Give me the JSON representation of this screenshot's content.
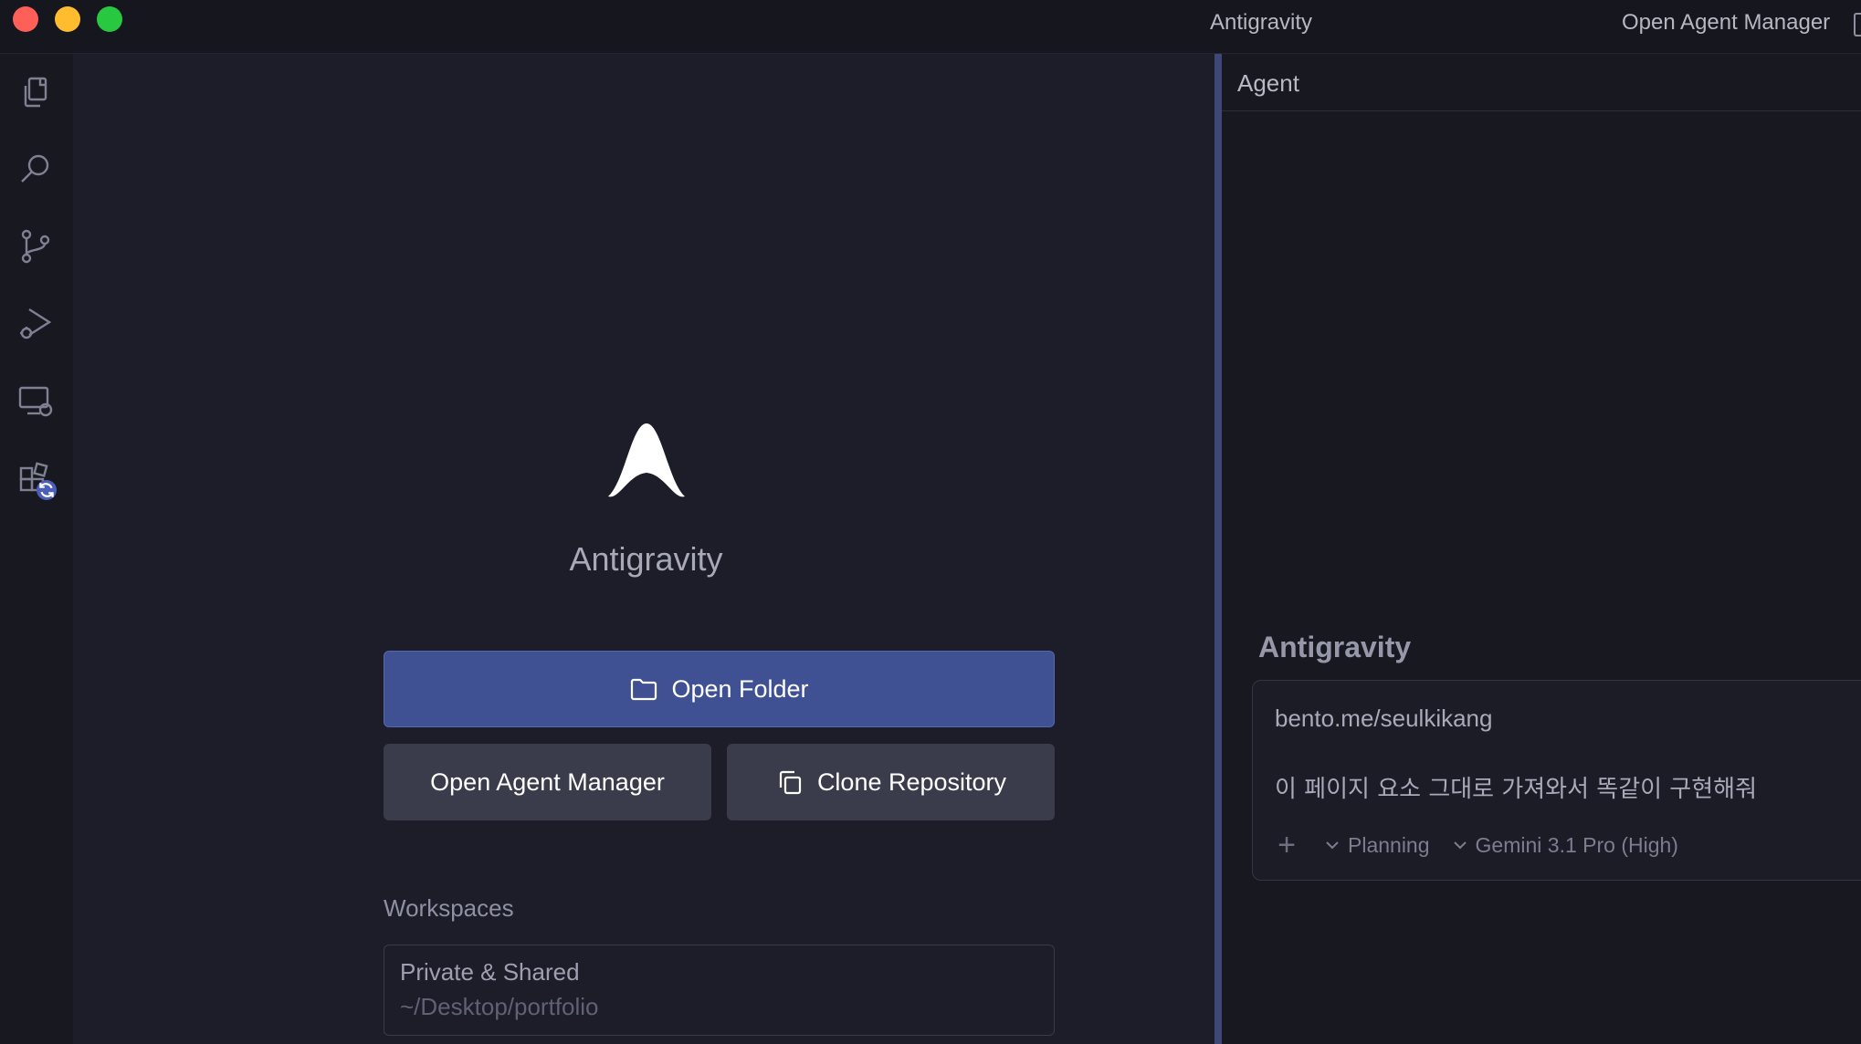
{
  "window": {
    "title": "Antigravity",
    "open_agent_manager": "Open Agent Manager"
  },
  "activity_bar": {
    "icons": [
      "explorer-icon",
      "search-icon",
      "source-control-icon",
      "run-debug-icon",
      "remote-explorer-icon",
      "extensions-icon"
    ]
  },
  "welcome": {
    "brand": "Antigravity",
    "open_folder": "Open Folder",
    "open_agent_manager": "Open Agent Manager",
    "clone_repository": "Clone Repository",
    "workspaces_heading": "Workspaces",
    "workspace": {
      "name": "Private & Shared",
      "path": "~/Desktop/portfolio"
    }
  },
  "agent_panel": {
    "header": "Agent",
    "title": "Antigravity",
    "prompt_line1": "bento.me/seulkikang",
    "prompt_line2": "이 페이지 요소 그대로 가져와서 똑같이 구현해줘",
    "mode": "Planning",
    "model": "Gemini 3.1 Pro (High)"
  },
  "colors": {
    "accent": "#3f5193",
    "sash": "#3e4778",
    "background": "#1c1d29"
  }
}
